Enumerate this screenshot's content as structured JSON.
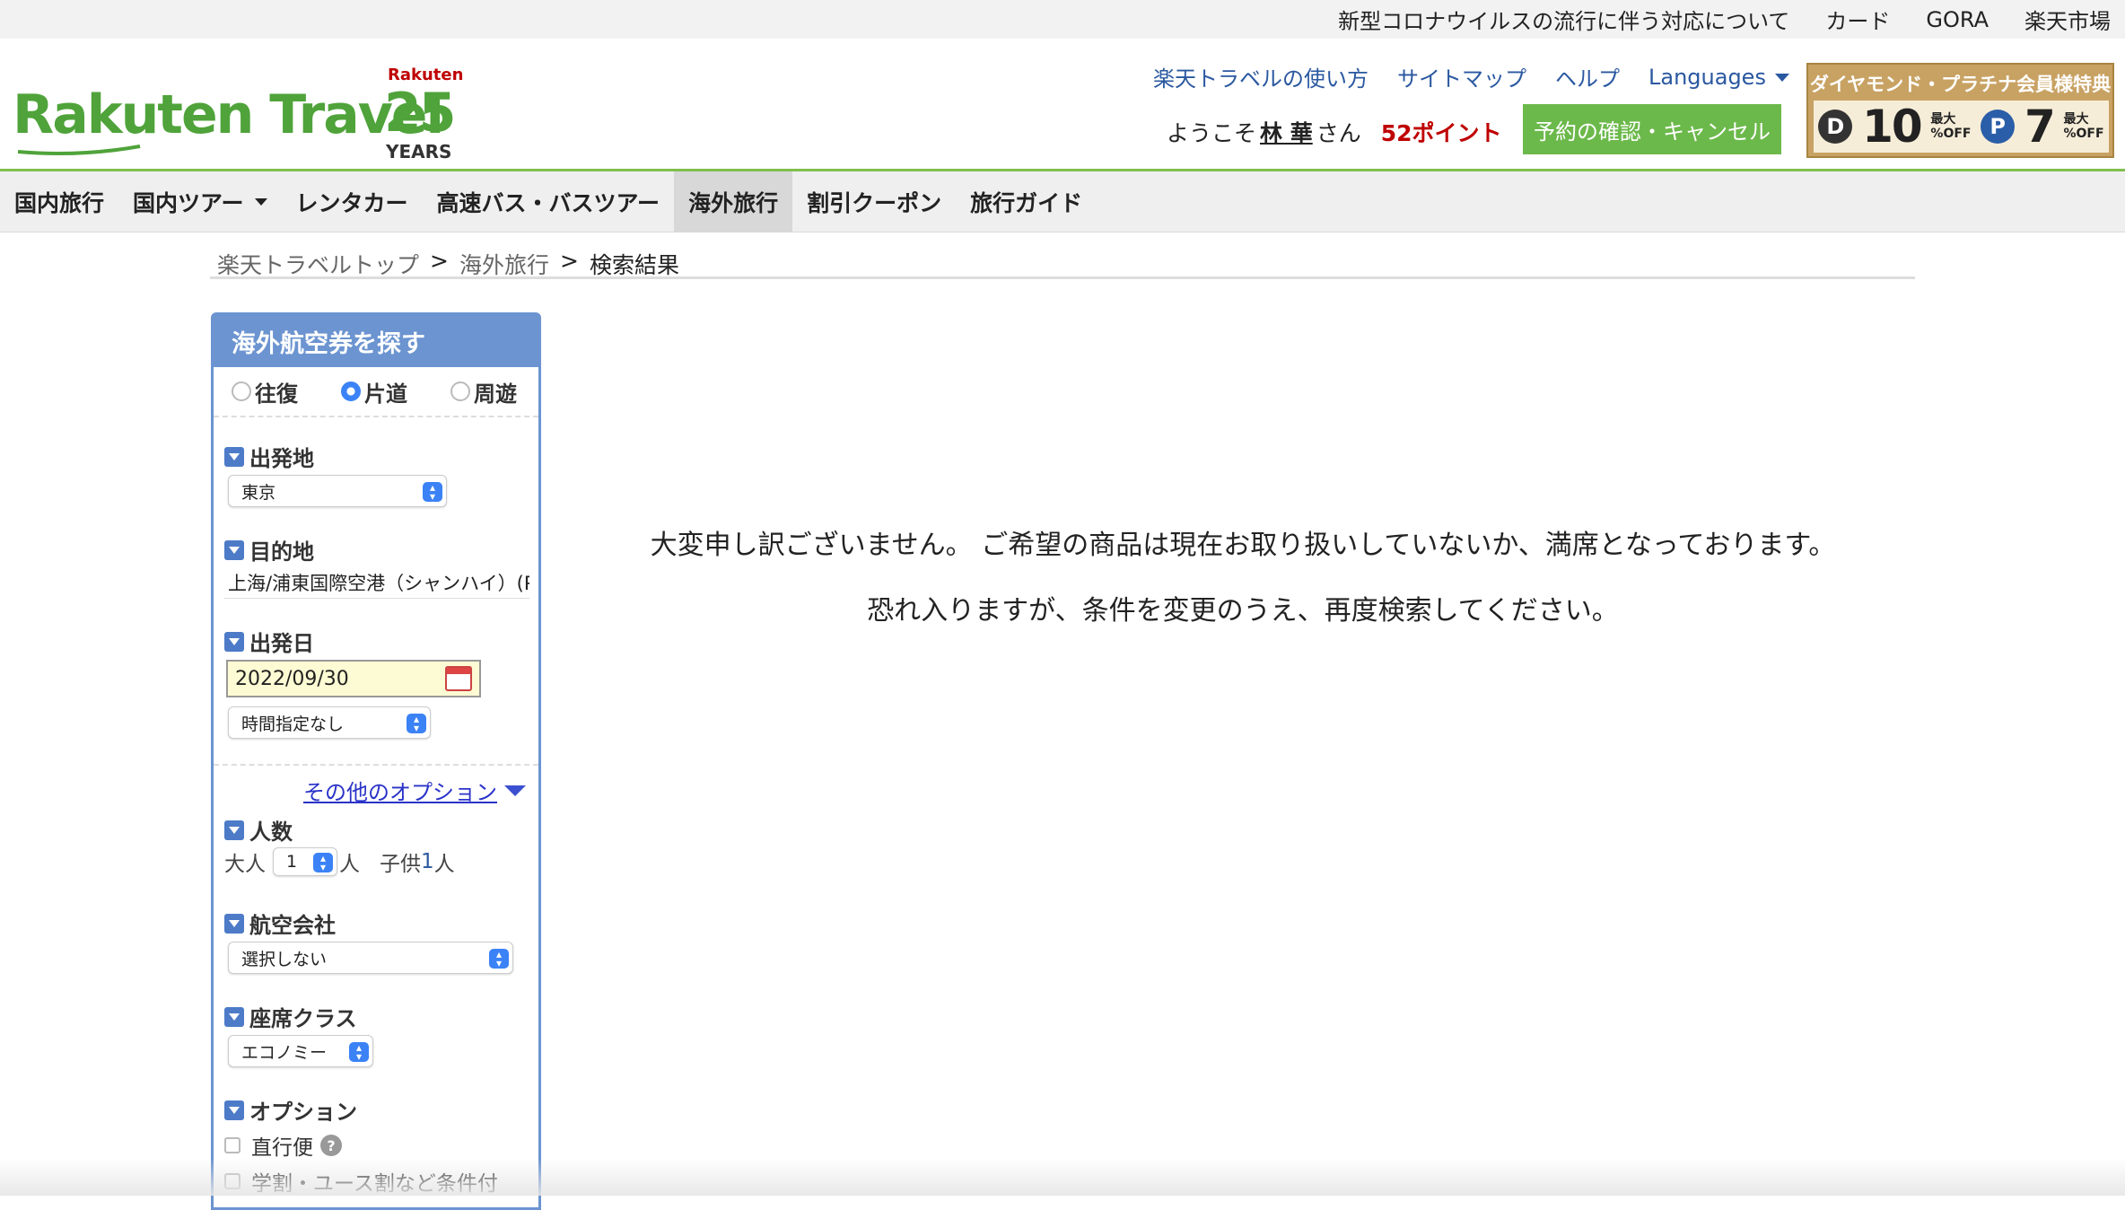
{
  "utility_links": [
    "新型コロナウイルスの流行に伴う対応について",
    "カード",
    "GORA",
    "楽天市場"
  ],
  "logo": {
    "text": "Rakuten Travel",
    "badge_brand": "Rakuten",
    "badge_number": "25",
    "badge_years": "YEARS"
  },
  "header_links": {
    "guide": "楽天トラベルの使い方",
    "sitemap": "サイトマップ",
    "help": "ヘルプ",
    "languages": "Languages"
  },
  "welcome": {
    "prefix": "ようこそ",
    "user_name": "林 華",
    "suffix": "さん",
    "points": "52ポイント"
  },
  "reservation_button": "予約の確認・キャンセル",
  "banner": {
    "title": "ダイヤモンド・プラチナ会員様特典",
    "d_coin": "D",
    "d_value": "10",
    "p_coin": "P",
    "p_value": "7",
    "max_label": "最大",
    "off_label": "%OFF"
  },
  "nav": {
    "items": [
      "国内旅行",
      "国内ツアー",
      "レンタカー",
      "高速バス・バスツアー",
      "海外旅行",
      "割引クーポン",
      "旅行ガイド"
    ],
    "active": "海外旅行"
  },
  "breadcrumb": {
    "top": "楽天トラベルトップ",
    "overseas": "海外旅行",
    "current": "検索結果",
    "sep": ">"
  },
  "search": {
    "title": "海外航空券を探す",
    "trip_types": [
      "往復",
      "片道",
      "周遊"
    ],
    "trip_selected": "片道",
    "departure_label": "出発地",
    "departure_value": "東京",
    "destination_label": "目的地",
    "destination_value": "上海/浦東国際空港（シャンハイ）(P",
    "date_label": "出発日",
    "date_value": "2022/09/30",
    "time_value": "時間指定なし",
    "other_options": "その他のオプション",
    "pax_label": "人数",
    "adult_label": "大人",
    "adult_value": "1",
    "person_unit": "人",
    "child_label": "子供",
    "child_value": "1",
    "airline_label": "航空会社",
    "airline_value": "選択しない",
    "class_label": "座席クラス",
    "class_value": "エコノミー",
    "options_label": "オプション",
    "opt_direct": "直行便",
    "opt_student": "学割・ユース割など条件付"
  },
  "message": {
    "line1": "大変申し訳ございません。 ご希望の商品は現在お取り扱いしていないか、満席となっております。",
    "line2": "恐れ入りますが、条件を変更のうえ、再度検索してください。"
  },
  "colors": {
    "brand_green": "#4fa33a",
    "link_blue": "#2a58a0",
    "panel_blue": "#6b94d0",
    "points_red": "#bf0000"
  }
}
